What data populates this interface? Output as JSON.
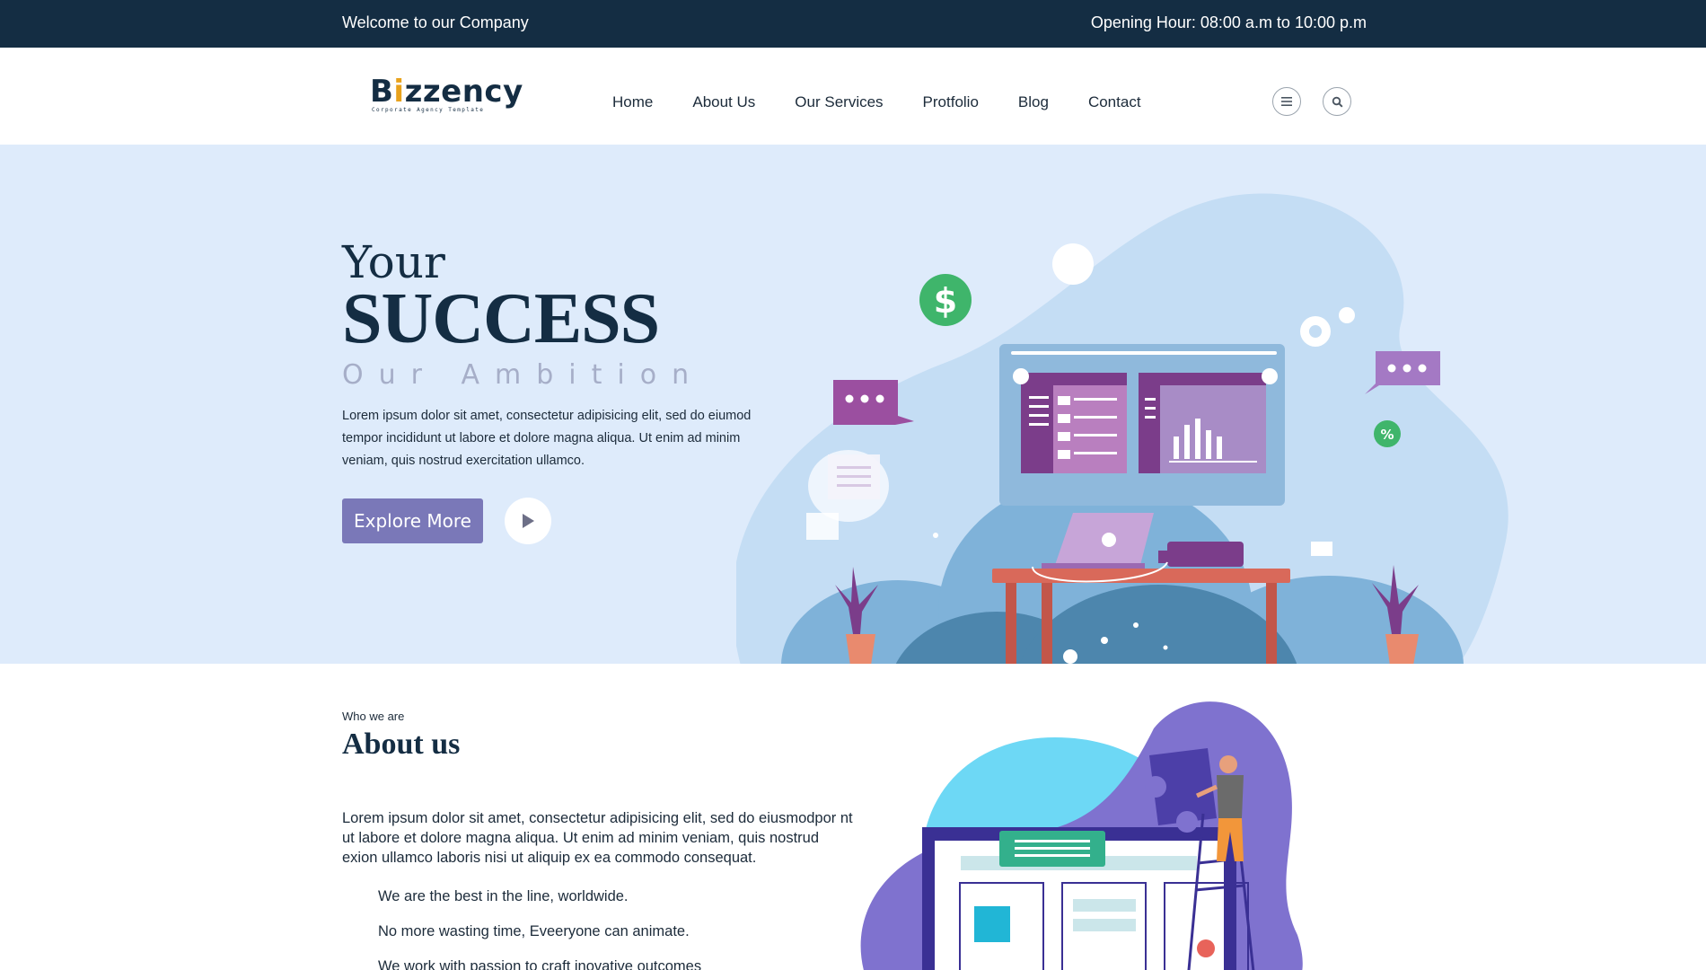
{
  "topbar": {
    "welcome": "Welcome to our Company",
    "hours": "Opening Hour: 08:00 a.m to 10:00 p.m"
  },
  "header": {
    "logo": {
      "name_start": "B",
      "name_i": "i",
      "name_end": "zzency",
      "tagline": "Corporate Agency Template"
    },
    "nav": [
      "Home",
      "About Us",
      "Our Services",
      "Protfolio",
      "Blog",
      "Contact"
    ],
    "icons": [
      "menu-icon",
      "search-icon"
    ]
  },
  "hero": {
    "line1": "Your",
    "line2": "SUCCESS",
    "line3": "Our Ambition",
    "description": "Lorem ipsum dolor sit amet, consectetur adipisicing elit, sed do eiumod tempor incididunt ut labore et dolore magna aliqua. Ut enim ad minim veniam, quis nostrud exercitation ullamco.",
    "cta": "Explore More",
    "illustration": {
      "dollar": "$",
      "percent": "%"
    }
  },
  "about": {
    "eyebrow": "Who we are",
    "title": "About us",
    "paragraph": "Lorem ipsum dolor sit amet, consectetur adipisicing elit, sed do eiusmodpor nt ut labore et dolore magna aliqua. Ut enim ad minim veniam, quis nostrud exion ullamco laboris nisi ut aliquip ex ea commodo consequat.",
    "bullets": [
      "We are the best in the line, worldwide.",
      "No more wasting time, Eveeryone can animate.",
      "We work with passion to craft inovative outcomes"
    ]
  },
  "colors": {
    "navy": "#142d43",
    "hero_bg": "#deebfb",
    "button": "#7a78b8",
    "muted_text": "#a6aec8"
  }
}
